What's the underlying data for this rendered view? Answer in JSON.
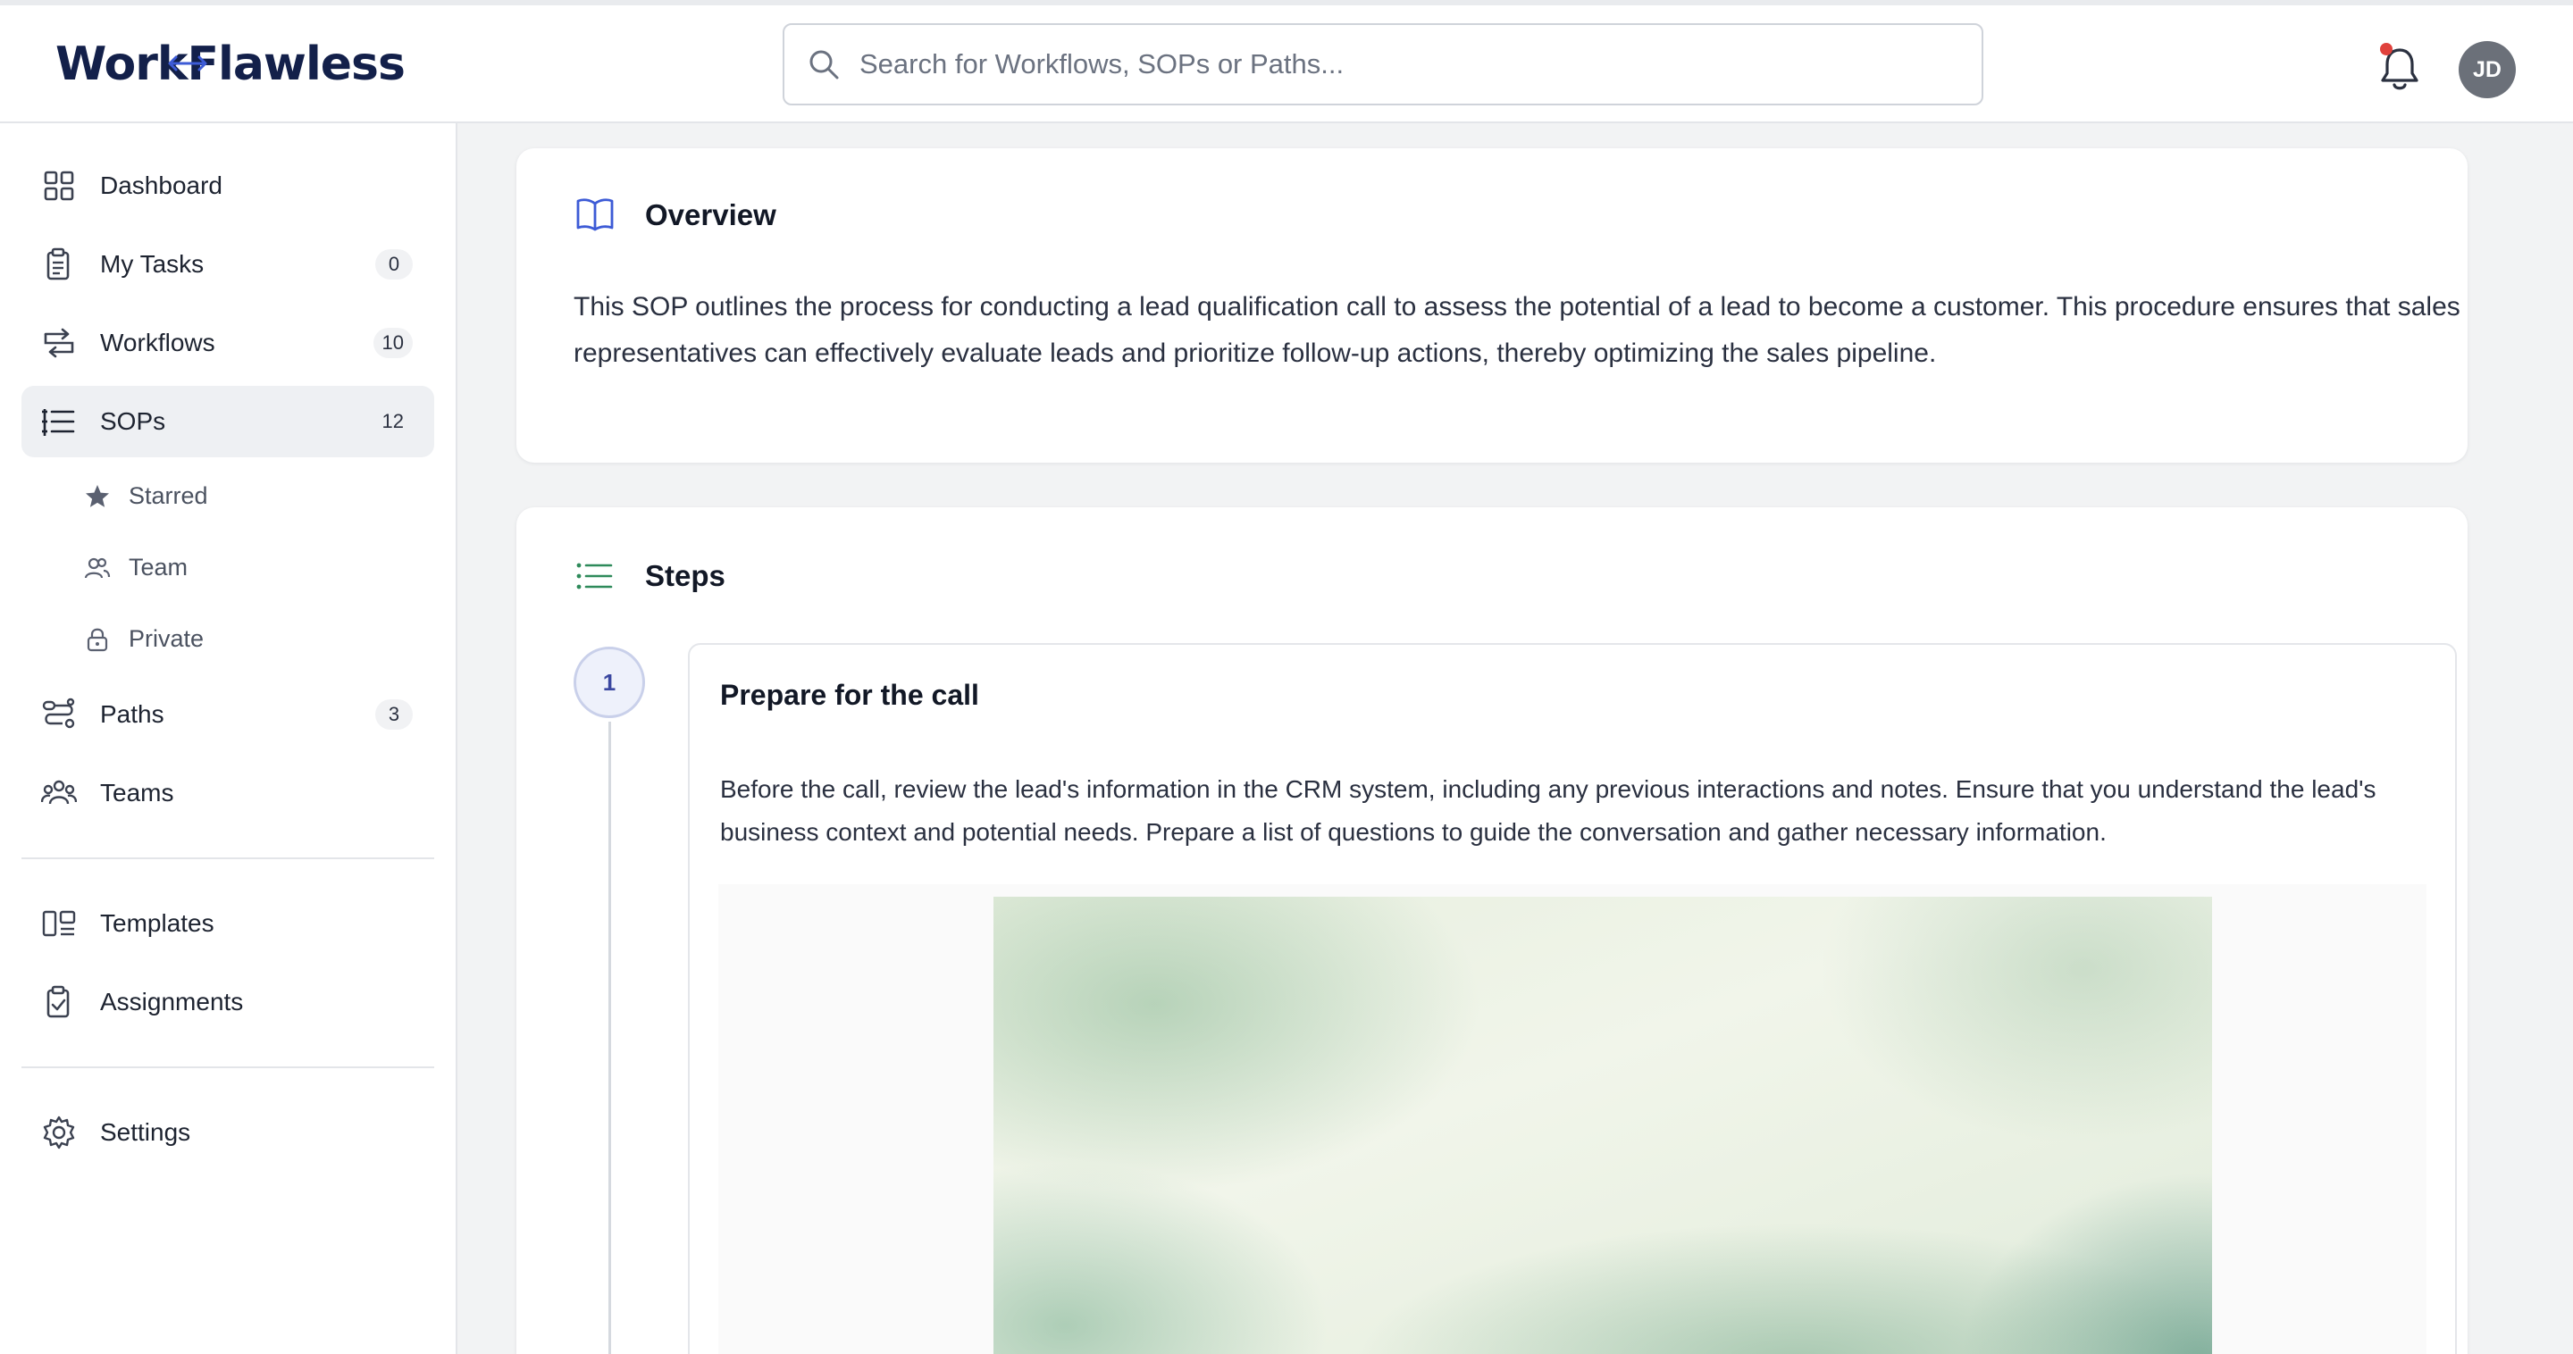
{
  "header": {
    "logo_text_left": "Work",
    "logo_text_right": "Flawless",
    "search_placeholder": "Search for Workflows, SOPs or Paths...",
    "avatar_initials": "JD",
    "notification_dot_color": "#e0413c"
  },
  "sidebar": {
    "items": [
      {
        "label": "Dashboard",
        "icon": "grid-icon"
      },
      {
        "label": "My Tasks",
        "icon": "clipboard-icon",
        "badge": "0"
      },
      {
        "label": "Workflows",
        "icon": "workflow-icon",
        "badge": "10"
      },
      {
        "label": "SOPs",
        "icon": "list-icon",
        "badge": "12",
        "active": true
      },
      {
        "label": "Paths",
        "icon": "path-icon",
        "badge": "3"
      },
      {
        "label": "Teams",
        "icon": "users-icon"
      },
      {
        "label": "Templates",
        "icon": "template-icon"
      },
      {
        "label": "Assignments",
        "icon": "clipboard-check-icon"
      },
      {
        "label": "Settings",
        "icon": "gear-icon"
      }
    ],
    "sop_subitems": [
      {
        "label": "Starred",
        "icon": "star-icon"
      },
      {
        "label": "Team",
        "icon": "team-icon"
      },
      {
        "label": "Private",
        "icon": "lock-icon"
      }
    ]
  },
  "overview": {
    "title": "Overview",
    "icon": "book-icon",
    "text": "This SOP outlines the process for conducting a lead qualification call to assess the potential of a lead to become a customer. This procedure ensures that sales representatives can effectively evaluate leads and prioritize follow-up actions, thereby optimizing the sales pipeline."
  },
  "steps": {
    "title": "Steps",
    "icon": "list-icon",
    "items": [
      {
        "number": "1",
        "title": "Prepare for the call",
        "description": "Before the call, review the lead's information in the CRM system, including any previous interactions and notes. Ensure that you understand the lead's business context and potential needs. Prepare a list of questions to guide the conversation and gather necessary information."
      }
    ]
  },
  "colors": {
    "accent_blue": "#3a47a0",
    "overview_icon": "#3d5bd6",
    "steps_icon": "#2e8a5a"
  }
}
